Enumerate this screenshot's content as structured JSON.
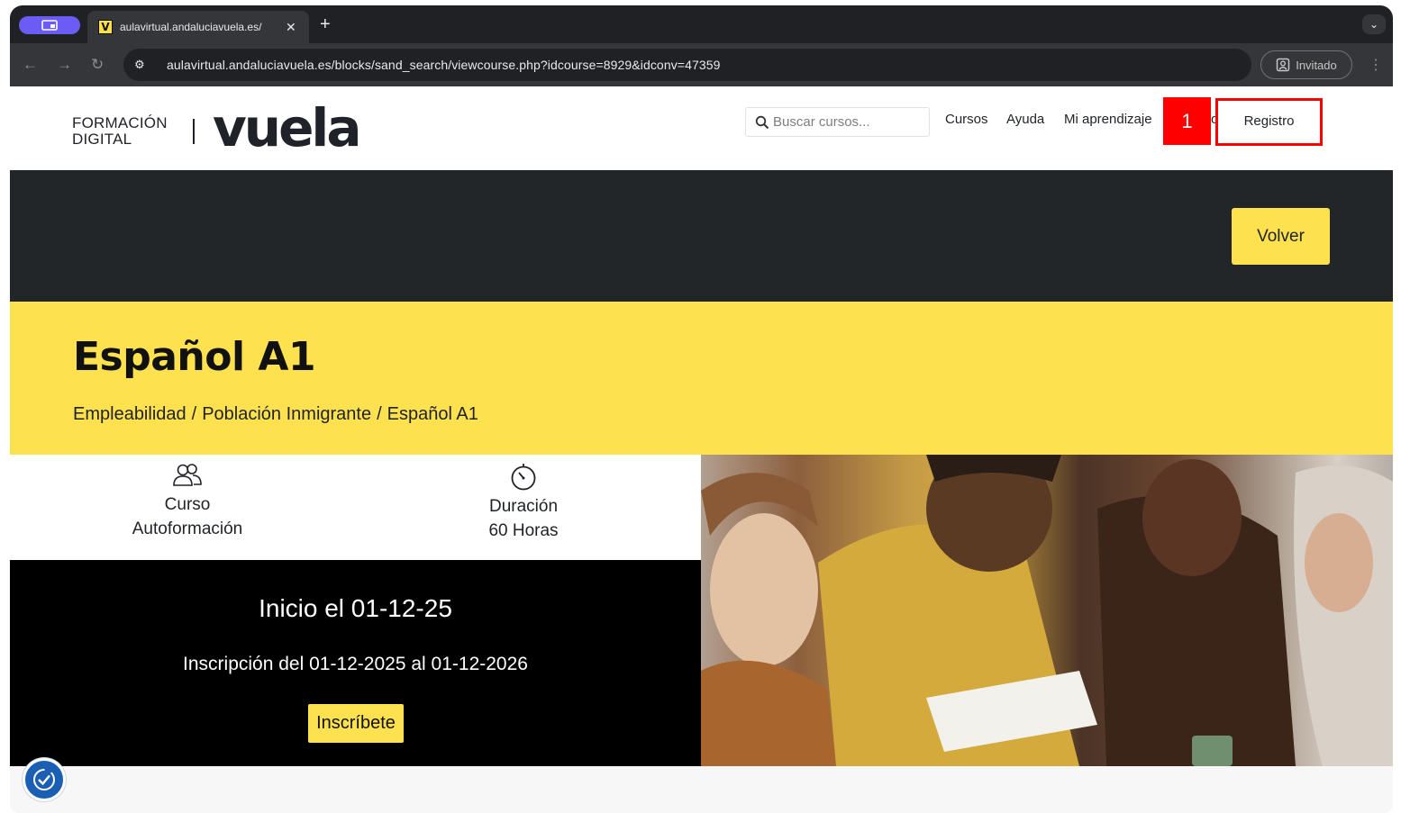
{
  "browser": {
    "tab_title": "aulavirtual.andaluciavuela.es/",
    "favicon_letter": "V",
    "url": "aulavirtual.andaluciavuela.es/blocks/sand_search/viewcourse.php?idcourse=8929&idconv=47359",
    "profile_label": "Invitado"
  },
  "header": {
    "logo_line1": "FORMACIÓN",
    "logo_line2": "DIGITAL",
    "logo_brand": "vuela",
    "search_placeholder": "Buscar cursos...",
    "nav": {
      "cursos": "Cursos",
      "ayuda": "Ayuda",
      "mi_aprendizaje": "Mi aprendizaje",
      "hidden_fragment": "o",
      "registro": "Registro"
    },
    "callout_number": "1"
  },
  "banner": {
    "back_button": "Volver"
  },
  "course": {
    "title": "Español A1",
    "breadcrumb": [
      "Empleabilidad",
      "/",
      "Población Inmigrante",
      "/",
      "Español A1"
    ],
    "type_line1": "Curso",
    "type_line2": "Autoformación",
    "duration_line1": "Duración",
    "duration_line2": "60 Horas",
    "start": "Inicio el 01-12-25",
    "enrollment": "Inscripción del 01-12-2025 al 01-12-2026",
    "enroll_button": "Inscríbete"
  },
  "colors": {
    "brand_yellow": "#fde14f",
    "dark_band": "#222628",
    "callout_red": "#ff0000",
    "a11y_blue": "#1a5fb4"
  }
}
